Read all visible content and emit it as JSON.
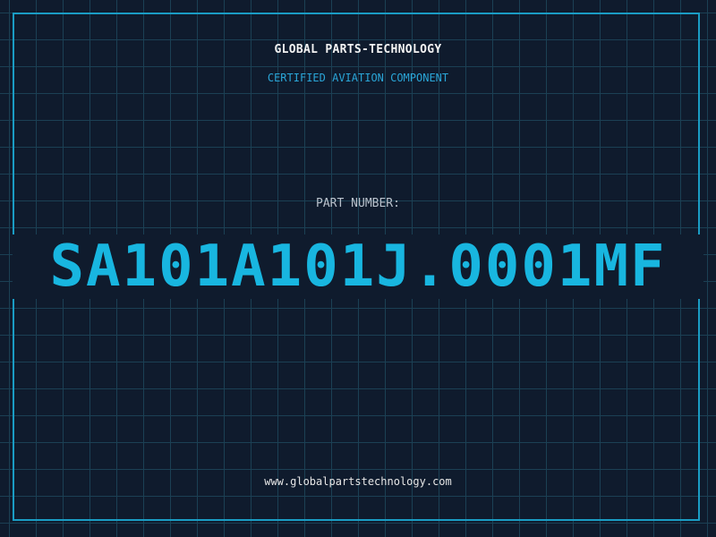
{
  "header": {
    "company": "GLOBAL PARTS-TECHNOLOGY",
    "tagline": "CERTIFIED AVIATION COMPONENT"
  },
  "part": {
    "label": "PART NUMBER:",
    "number": "SA101A101J.0001MF"
  },
  "footer": {
    "url": "www.globalpartstechnology.com"
  },
  "colors": {
    "background": "#0f1b2d",
    "grid": "#1b4054",
    "accent": "#18b6e0",
    "frame": "#1a9cc4"
  }
}
